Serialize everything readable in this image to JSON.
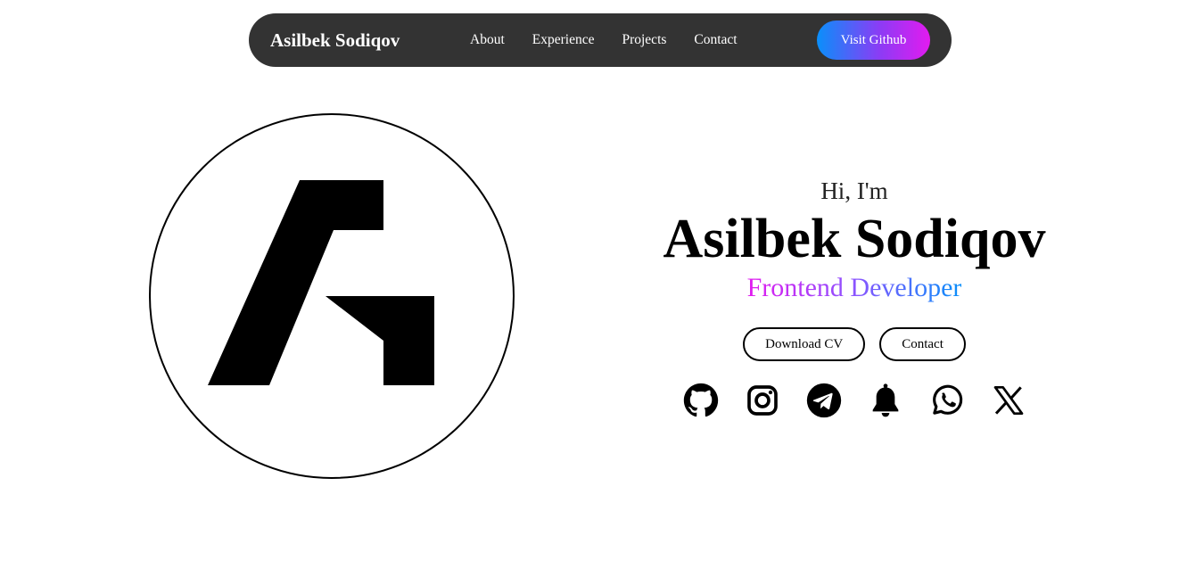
{
  "nav": {
    "brand": "Asilbek Sodiqov",
    "links": [
      {
        "label": "About"
      },
      {
        "label": "Experience"
      },
      {
        "label": "Projects"
      },
      {
        "label": "Contact"
      }
    ],
    "cta_label": "Visit Github",
    "background_color": "#333333",
    "cta_gradient": [
      "#0a8ffa",
      "#e21bef"
    ]
  },
  "logo": {
    "icon": "asilbek-a-logo-icon",
    "color": "#000000"
  },
  "hero": {
    "greeting": "Hi, I'm",
    "name": "Asilbek Sodiqov",
    "role": "Frontend Developer",
    "role_gradient": [
      "#e21bef",
      "#8b54ff",
      "#0a8ffa"
    ],
    "buttons": [
      {
        "label": "Download CV"
      },
      {
        "label": "Contact"
      }
    ],
    "socials": [
      {
        "icon": "github-icon"
      },
      {
        "icon": "instagram-icon"
      },
      {
        "icon": "telegram-icon"
      },
      {
        "icon": "bell-icon"
      },
      {
        "icon": "whatsapp-icon"
      },
      {
        "icon": "x-twitter-icon"
      }
    ]
  }
}
